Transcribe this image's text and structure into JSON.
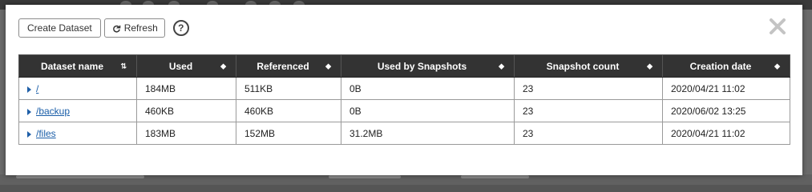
{
  "toolbar": {
    "create_label": "Create Dataset",
    "refresh_label": "Refresh",
    "help_glyph": "?"
  },
  "table": {
    "columns": [
      "Dataset name",
      "Used",
      "Referenced",
      "Used by Snapshots",
      "Snapshot count",
      "Creation date"
    ],
    "rows": [
      {
        "name": "/",
        "used": "184MB",
        "referenced": "511KB",
        "snap_used": "0B",
        "snap_count": "23",
        "created": "2020/04/21 11:02"
      },
      {
        "name": "/backup",
        "used": "460KB",
        "referenced": "460KB",
        "snap_used": "0B",
        "snap_count": "23",
        "created": "2020/06/02 13:25"
      },
      {
        "name": "/files",
        "used": "183MB",
        "referenced": "152MB",
        "snap_used": "31.2MB",
        "snap_count": "23",
        "created": "2020/04/21 11:02"
      }
    ]
  },
  "icons": {
    "refresh": "refresh-icon",
    "help": "help-icon",
    "close": "close-icon",
    "sort": "sort-icon",
    "expand": "expand-caret-icon"
  },
  "colors": {
    "header_bg": "#333333",
    "link": "#1a5ea8",
    "overlay": "#6b6b6b"
  }
}
